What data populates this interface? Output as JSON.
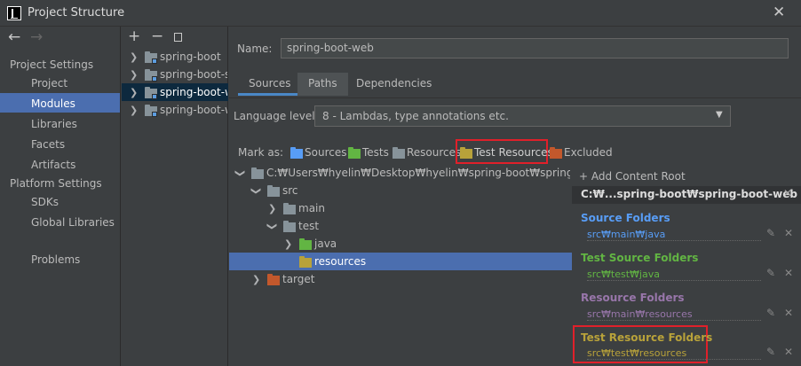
{
  "window": {
    "title": "Project Structure"
  },
  "sidebar": {
    "section_project": "Project Settings",
    "project_items": [
      "Project",
      "Modules",
      "Libraries",
      "Facets",
      "Artifacts"
    ],
    "section_platform": "Platform Settings",
    "platform_items": [
      "SDKs",
      "Global Libraries"
    ],
    "problems": "Problems",
    "selected": "Modules"
  },
  "modules": {
    "items": [
      "spring-boot",
      "spring-boot-st",
      "spring-boot-w",
      "spring-boot-w"
    ],
    "selected_index": 2
  },
  "name": {
    "label": "Name:",
    "value": "spring-boot-web"
  },
  "tabs": [
    "Sources",
    "Paths",
    "Dependencies"
  ],
  "language_level": {
    "label": "Language level:",
    "value": "8 - Lambdas, type annotations etc."
  },
  "mark_as": {
    "label": "Mark as:",
    "items": [
      "Sources",
      "Tests",
      "Resources",
      "Test Resources",
      "Excluded"
    ]
  },
  "tree": {
    "root": "C:₩Users₩hyelin₩Desktop₩hyelin₩spring-boot₩spring-boot-we",
    "nodes": [
      "src",
      "main",
      "test",
      "java",
      "resources",
      "target"
    ]
  },
  "content_root": {
    "add_label": "+ Add Content Root",
    "header": "C:₩...spring-boot₩spring-boot-web",
    "source_title": "Source Folders",
    "source_path": "src₩main₩java",
    "test_source_title": "Test Source Folders",
    "test_source_path": "src₩test₩java",
    "resource_title": "Resource Folders",
    "resource_path": "src₩main₩resources",
    "test_resource_title": "Test Resource Folders",
    "test_resource_path": "src₩test₩resources"
  },
  "colors": {
    "accent": "#4b6eaf",
    "source": "#589df6",
    "test_source": "#62b543",
    "resource": "#9876aa",
    "test_resource": "#b8a23a",
    "excluded": "#c3582c",
    "highlight": "#e0202a"
  }
}
